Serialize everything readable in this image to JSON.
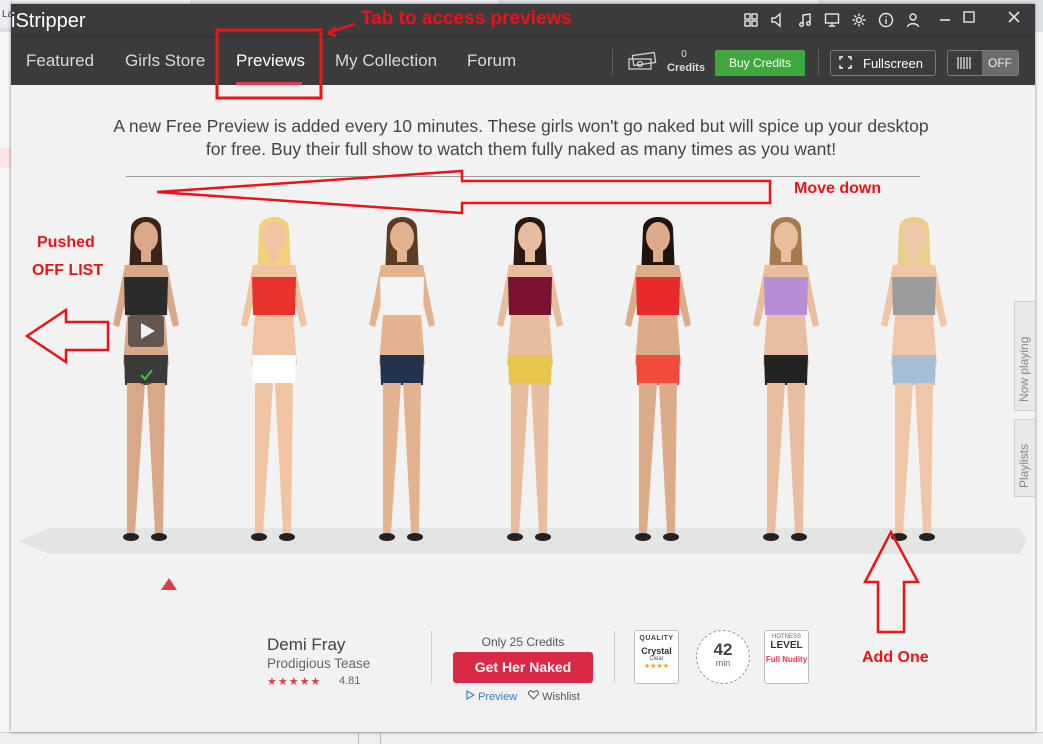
{
  "browser": {
    "tabs": [
      "La",
      "",
      "",
      ""
    ]
  },
  "app": {
    "logo_text": "iStripper",
    "titlebar_icons": [
      "grid-icon",
      "speaker-icon",
      "music-icon",
      "monitor-icon",
      "gear-icon",
      "info-icon",
      "user-icon"
    ],
    "window_buttons": [
      "minimize",
      "maximize",
      "close"
    ],
    "nav": {
      "tabs": [
        "Featured",
        "Girls Store",
        "Previews",
        "My Collection",
        "Forum"
      ],
      "active_tab": "Previews",
      "credits_count": "0",
      "credits_label": "Credits",
      "buy_credits": "Buy Credits",
      "fullscreen": "Fullscreen",
      "toggle_state": "OFF"
    },
    "intro_text": "A new Free Preview is added every 10 minutes. These girls won't go naked but will spice up your desktop for free. Buy their full show to watch them fully naked as many times as you want!",
    "side_tabs": [
      "Now playing",
      "Playlists"
    ],
    "models": [
      {
        "outfit": "black lingerie",
        "colors": [
          "#2b2b2b",
          "#3a3a3a"
        ],
        "skin": "#d8a889",
        "hair": "#3a2418",
        "selected": true
      },
      {
        "outfit": "red santa babydoll",
        "colors": [
          "#e8322e",
          "#ffffff"
        ],
        "skin": "#f0c3a2",
        "hair": "#f1d27a",
        "selected": false
      },
      {
        "outfit": "white top denim shorts",
        "colors": [
          "#f4f4f4",
          "#22324f"
        ],
        "skin": "#e3b28f",
        "hair": "#5a3d24",
        "selected": false
      },
      {
        "outfit": "burgundy stewardess",
        "colors": [
          "#7a1330",
          "#e8c64a"
        ],
        "skin": "#e8bd9d",
        "hair": "#2a1a12",
        "selected": false
      },
      {
        "outfit": "red strappy lingerie",
        "colors": [
          "#e82a2a",
          "#f24b3c"
        ],
        "skin": "#dcac8a",
        "hair": "#1e1410",
        "selected": false
      },
      {
        "outfit": "purple satin slip",
        "colors": [
          "#b58ed6",
          "#222222"
        ],
        "skin": "#e9bea0",
        "hair": "#a77a4d",
        "selected": false
      },
      {
        "outfit": "grey crop top jeans",
        "colors": [
          "#9c9c9c",
          "#a4bfd8"
        ],
        "skin": "#efc6a8",
        "hair": "#e8cf8a",
        "selected": false
      }
    ],
    "selected_model": {
      "name": "Demi Fray",
      "show_title": "Prodigious Tease",
      "stars": "★★★★★",
      "rating": "4.81",
      "price_text": "Only 25 Credits",
      "cta": "Get Her Naked",
      "preview_link": "Preview",
      "wishlist_link": "Wishlist",
      "quality_heading": "QUALITY",
      "quality_value": "Crystal",
      "quality_sub": "Clear",
      "quality_stars": "★★★★",
      "duration": "42",
      "duration_unit": "min",
      "hotness_heading": "HOTNESS",
      "hotness_label": "LEVEL",
      "hotness_value": "Full Nudity"
    }
  },
  "annotations": {
    "tab_note": "Tab to access previews",
    "move_down": "Move down",
    "pushed_line1": "Pushed",
    "pushed_line2": "OFF LIST",
    "add_one": "Add One",
    "color": "#e8141a"
  }
}
